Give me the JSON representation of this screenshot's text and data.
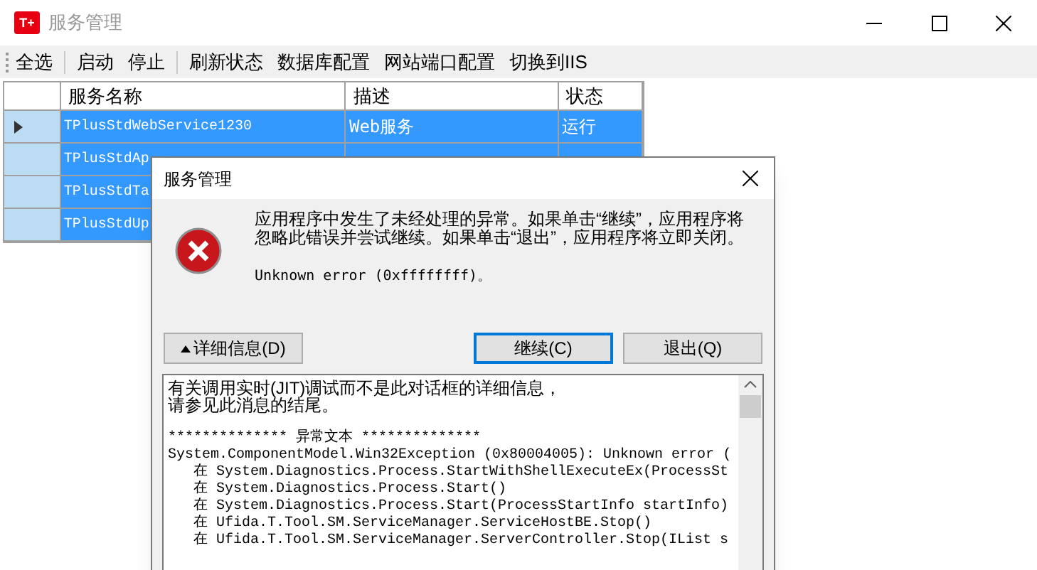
{
  "window": {
    "title": "服务管理",
    "logo": "T+"
  },
  "toolbar": {
    "groups": [
      [
        "全选"
      ],
      [
        "启动",
        "停止"
      ],
      [
        "刷新状态",
        "数据库配置",
        "网站端口配置",
        "切换到IIS"
      ]
    ]
  },
  "grid": {
    "columns": [
      "服务名称",
      "描述",
      "状态"
    ],
    "rows": [
      {
        "selected": true,
        "current": true,
        "cells": [
          "TPlusStdWebService1230",
          "Web服务",
          "运行"
        ]
      },
      {
        "selected": true,
        "current": false,
        "cells": [
          "TPlusStdAp"
        ]
      },
      {
        "selected": true,
        "current": false,
        "cells": [
          "TPlusStdTa"
        ]
      },
      {
        "selected": true,
        "current": false,
        "cells": [
          "TPlusStdUp"
        ]
      }
    ]
  },
  "dialog": {
    "title": "服务管理",
    "message": "应用程序中发生了未经处理的异常。如果单击“继续”，应用程序将忽略此错误并尝试继续。如果单击“退出”，应用程序将立即关闭。",
    "error": "Unknown error (0xffffffff)。",
    "buttons": [
      {
        "label": "详细信息(D)",
        "kind": "details"
      },
      {
        "label": "继续(C)",
        "kind": "default"
      },
      {
        "label": "退出(Q)",
        "kind": "normal"
      }
    ],
    "details": [
      {
        "text": "有关调用实时(JIT)调试而不是此对话框的详细信息，",
        "kind": "note"
      },
      {
        "text": "请参见此消息的结尾。",
        "kind": "note"
      },
      {
        "text": "************** 异常文本 **************",
        "kind": "code"
      },
      {
        "text": "System.ComponentModel.Win32Exception (0x80004005): Unknown error (",
        "kind": "code"
      },
      {
        "text": "   在 System.Diagnostics.Process.StartWithShellExecuteEx(ProcessSt",
        "kind": "code"
      },
      {
        "text": "   在 System.Diagnostics.Process.Start()",
        "kind": "code"
      },
      {
        "text": "   在 System.Diagnostics.Process.Start(ProcessStartInfo startInfo)",
        "kind": "code"
      },
      {
        "text": "   在 Ufida.T.Tool.SM.ServiceManager.ServiceHostBE.Stop()",
        "kind": "code"
      },
      {
        "text": "   在 Ufida.T.Tool.SM.ServiceManager.ServerController.Stop(IList s",
        "kind": "code"
      }
    ]
  }
}
